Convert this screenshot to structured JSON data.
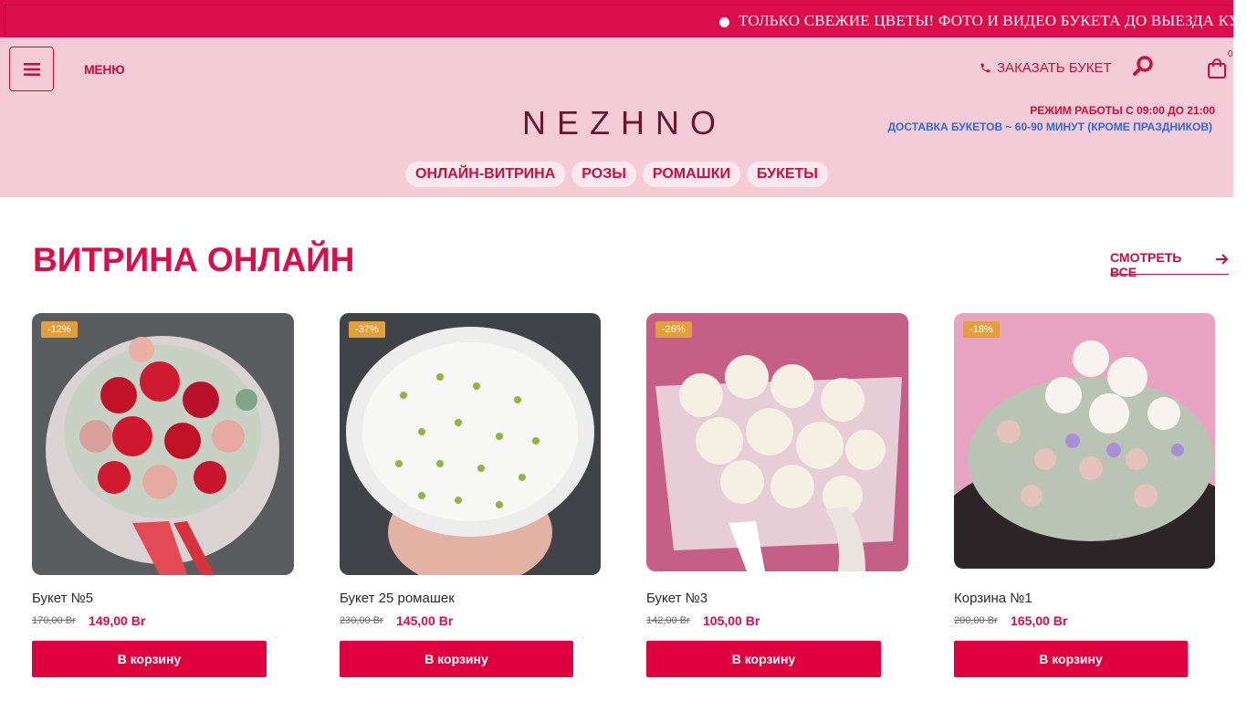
{
  "ticker": {
    "text": "ТОЛЬКО СВЕЖИЕ ЦВЕТЫ! ФОТО И ВИДЕО БУКЕТА ДО ВЫЕЗДА КУР"
  },
  "header": {
    "menu_label": "МЕНЮ",
    "order_label": "ЗАКАЗАТЬ БУКЕТ",
    "cart_count": "0",
    "logo": "NEZHNO",
    "hours": "РЕЖИМ РАБОТЫ С 09:00 ДО 21:00",
    "delivery": "ДОСТАВКА БУКЕТОВ ~ 60-90 МИНУТ (КРОМЕ ПРАЗДНИКОВ)"
  },
  "nav": [
    "ОНЛАЙН-ВИТРИНА",
    "РОЗЫ",
    "РОМАШКИ",
    "БУКЕТЫ"
  ],
  "section": {
    "title": "ВИТРИНА ОНЛАЙН",
    "see_all": "СМОТРЕТЬ ВСЕ"
  },
  "products": [
    {
      "badge": "-12%",
      "name": "Букет №5",
      "old_price": "170,00 Br",
      "price": "149,00 Br",
      "button": "В корзину"
    },
    {
      "badge": "-37%",
      "name": "Букет 25 ромашек",
      "old_price": "230,00 Br",
      "price": "145,00 Br",
      "button": "В корзину"
    },
    {
      "badge": "-26%",
      "name": "Букет №3",
      "old_price": "142,00 Br",
      "price": "105,00 Br",
      "button": "В корзину"
    },
    {
      "badge": "-18%",
      "name": "Корзина №1",
      "old_price": "200,00 Br",
      "price": "165,00 Br",
      "button": "В корзину"
    }
  ],
  "colors": {
    "brand": "#dc0d4b",
    "header_bg": "#f4ccd8",
    "badge": "#e2a03c",
    "link": "#2f6ad2"
  },
  "icons": [
    "menu-icon",
    "phone-icon",
    "search-icon",
    "shopping-bag-icon",
    "arrow-right-icon"
  ]
}
